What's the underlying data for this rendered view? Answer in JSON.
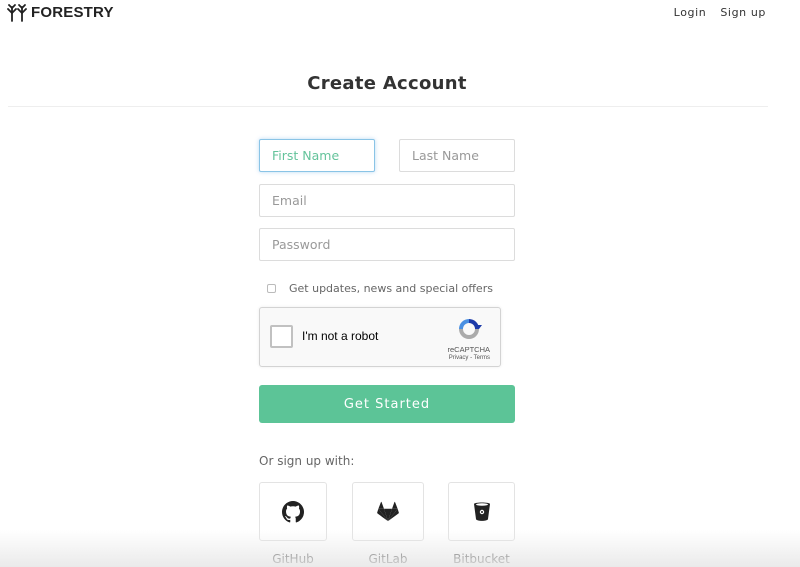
{
  "brand": {
    "name": "FORESTRY",
    "logo_icon": "forestry-trees-icon"
  },
  "nav": {
    "login": "Login",
    "signup": "Sign up"
  },
  "page": {
    "title": "Create Account"
  },
  "form": {
    "first_name": {
      "placeholder": "First Name",
      "value": ""
    },
    "last_name": {
      "placeholder": "Last Name",
      "value": ""
    },
    "email": {
      "placeholder": "Email",
      "value": ""
    },
    "password": {
      "placeholder": "Password",
      "value": ""
    },
    "optin_label": "Get updates, news and special offers",
    "optin_checked": false
  },
  "captcha": {
    "label": "I'm not a robot",
    "brand": "reCAPTCHA",
    "links": "Privacy - Terms",
    "checked": false
  },
  "submit": {
    "label": "Get Started",
    "color": "#5cc497"
  },
  "social": {
    "heading": "Or sign up with:",
    "providers": [
      {
        "label": "GitHub",
        "icon": "github-icon"
      },
      {
        "label": "GitLab",
        "icon": "gitlab-icon"
      },
      {
        "label": "Bitbucket",
        "icon": "bitbucket-icon"
      }
    ]
  }
}
